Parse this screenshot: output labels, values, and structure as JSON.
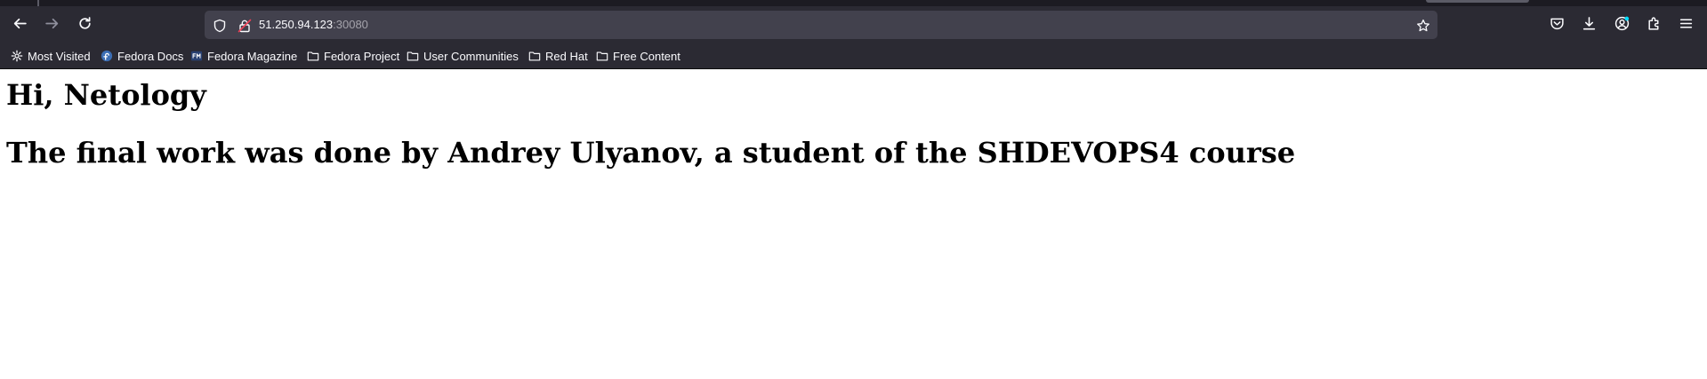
{
  "browser": {
    "url": {
      "host": "51.250.94.123",
      "port": ":30080"
    },
    "icons": {
      "back": "arrow-left-icon",
      "forward": "arrow-right-icon",
      "reload": "reload-icon",
      "tracking": "shield-icon",
      "connection": "lock-slash-icon",
      "bookmark_star": "star-icon",
      "pocket": "pocket-icon",
      "downloads": "download-icon",
      "account": "account-icon",
      "extensions": "puzzle-icon",
      "menu": "hamburger-icon"
    },
    "bookmarks": [
      {
        "label": "Most Visited",
        "icon": "gear-icon"
      },
      {
        "label": "Fedora Docs",
        "icon": "fedora-icon"
      },
      {
        "label": "Fedora Magazine",
        "icon": "fm-icon"
      },
      {
        "label": "Fedora Project",
        "icon": "folder-icon"
      },
      {
        "label": "User Communities",
        "icon": "folder-icon"
      },
      {
        "label": "Red Hat",
        "icon": "folder-icon"
      },
      {
        "label": "Free Content",
        "icon": "folder-icon"
      }
    ],
    "colors": {
      "toolbar": "#2b2a33",
      "urlbar": "#42414d",
      "account_badge": "#00ddff",
      "pocket": "#ef4056"
    }
  },
  "page": {
    "heading": "Hi, Netology",
    "subheading": "The final work was done by Andrey Ulyanov, a student of the SHDEVOPS4 course"
  }
}
